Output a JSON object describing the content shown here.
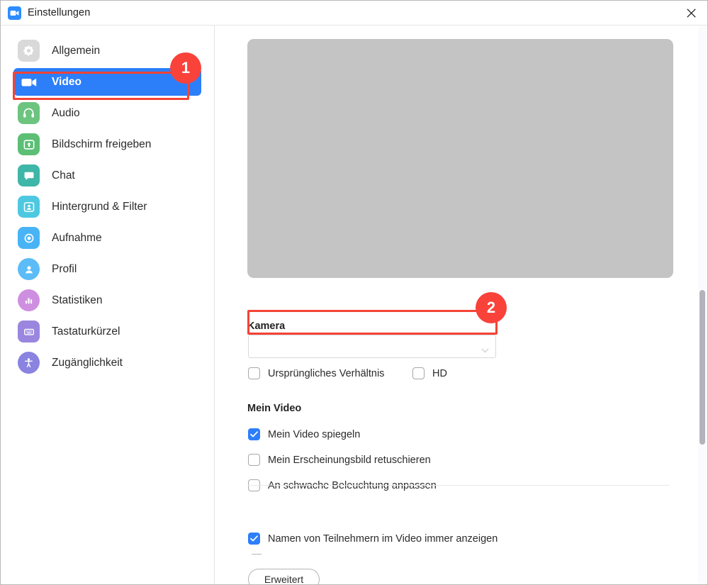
{
  "window": {
    "title": "Einstellungen",
    "app_icon": "zoom-video-icon",
    "close_label": "✕"
  },
  "colors": {
    "accent": "#2d7ff9",
    "annotation": "#f9423a",
    "annotation_box": "#f44336",
    "titlebar_icon": "#2d8cff",
    "video_preview": "#c4c4c4"
  },
  "sidebar": {
    "items": [
      {
        "label": "Allgemein",
        "icon": "gear-icon",
        "icon_bg": "#d9d9d9",
        "active": false
      },
      {
        "label": "Video",
        "icon": "video-camera-icon",
        "icon_bg": "#2d7ff9",
        "active": true
      },
      {
        "label": "Audio",
        "icon": "headphones-icon",
        "icon_bg": "#6cc47f",
        "active": false
      },
      {
        "label": "Bildschirm freigeben",
        "icon": "share-screen-icon",
        "icon_bg": "#5cbf75",
        "active": false
      },
      {
        "label": "Chat",
        "icon": "chat-bubble-icon",
        "icon_bg": "#3eb6a8",
        "active": false
      },
      {
        "label": "Hintergrund & Filter",
        "icon": "person-frame-icon",
        "icon_bg": "#4ec8e0",
        "active": false
      },
      {
        "label": "Aufnahme",
        "icon": "record-circle-icon",
        "icon_bg": "#49b4f5",
        "active": false
      },
      {
        "label": "Profil",
        "icon": "person-icon",
        "icon_bg": "#5bbcf7",
        "active": false
      },
      {
        "label": "Statistiken",
        "icon": "bar-chart-icon",
        "icon_bg": "#cf8fe0",
        "active": false
      },
      {
        "label": "Tastaturkürzel",
        "icon": "keyboard-icon",
        "icon_bg": "#9a86de",
        "active": false
      },
      {
        "label": "Zugänglichkeit",
        "icon": "accessibility-icon",
        "icon_bg": "#8a83e0",
        "active": false
      }
    ]
  },
  "annotations": [
    {
      "number": "1",
      "target": "sidebar-item-video"
    },
    {
      "number": "2",
      "target": "camera-select"
    }
  ],
  "main": {
    "video_preview": {
      "name": "video-preview"
    },
    "camera": {
      "title": "Kamera",
      "selected_value": "",
      "placeholder": "",
      "options": []
    },
    "camera_options": [
      {
        "label": "Ursprüngliches Verhältnis",
        "checked": false
      },
      {
        "label": "HD",
        "checked": false
      }
    ],
    "my_video": {
      "title": "Mein Video",
      "options": [
        {
          "label": "Mein Video spiegeln",
          "checked": true
        },
        {
          "label": "Mein Erscheinungsbild retuschieren",
          "checked": false
        },
        {
          "label": "An schwache Beleuchtung anpassen",
          "checked": false
        }
      ]
    },
    "participants": {
      "options": [
        {
          "label": "Namen von Teilnehmern im Video immer anzeigen",
          "checked": true
        }
      ]
    },
    "advanced_button": "Erweitert"
  }
}
